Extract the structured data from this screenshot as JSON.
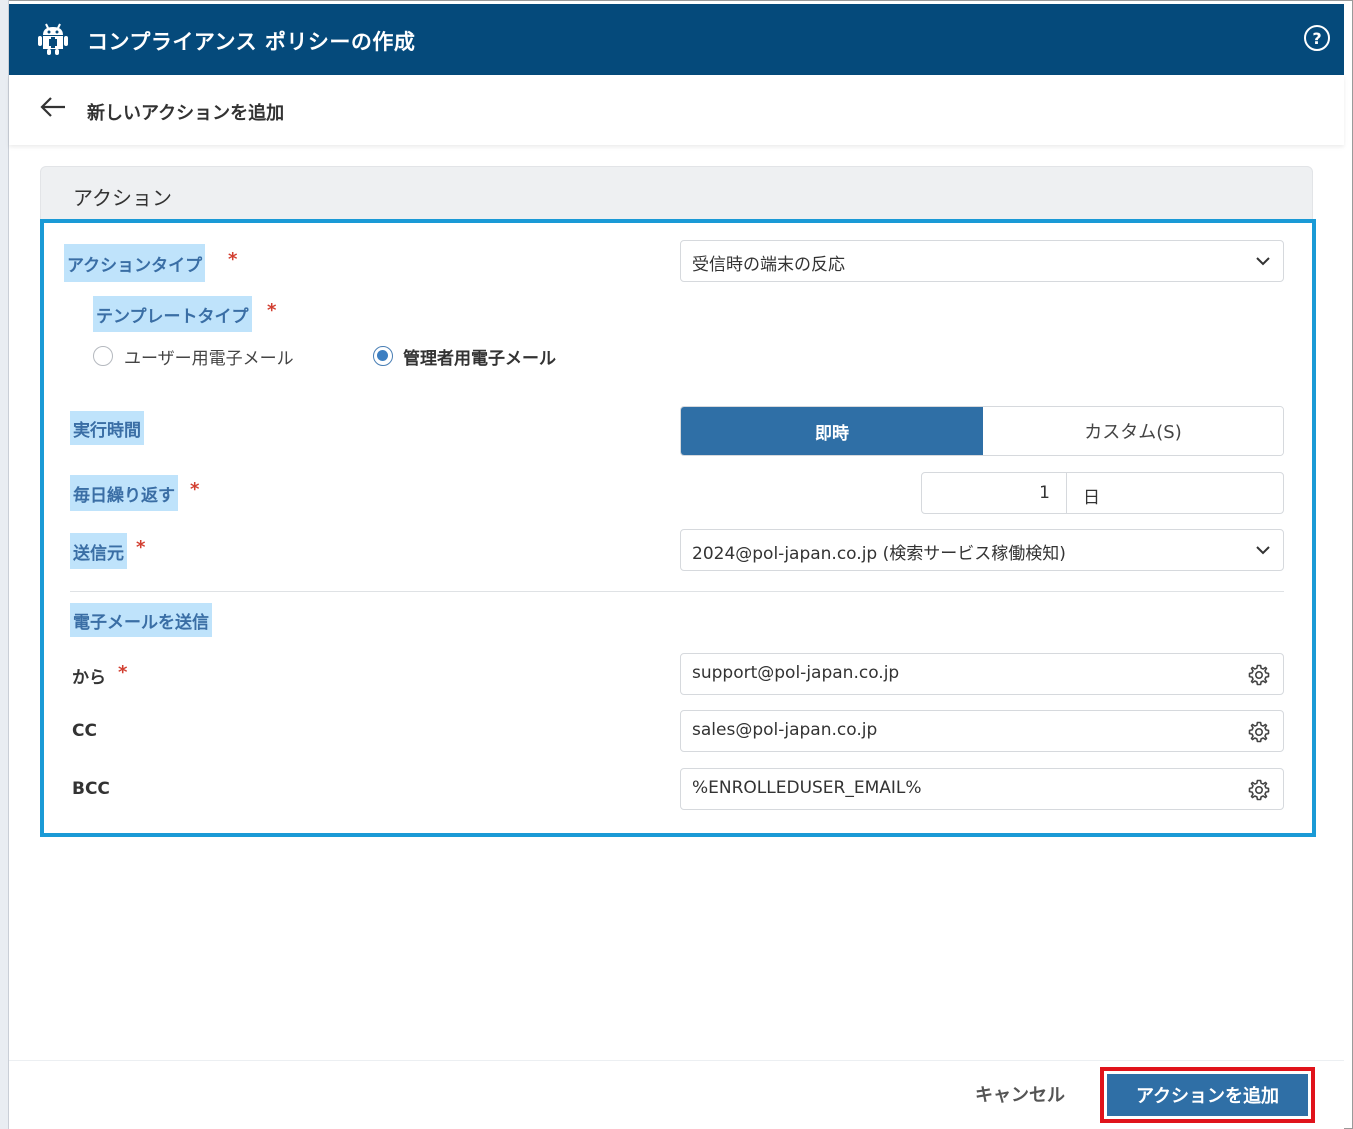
{
  "header": {
    "title": "コンプライアンス ポリシーの作成",
    "help_label": "?"
  },
  "subheader": {
    "title": "新しいアクションを追加"
  },
  "card": {
    "title": "アクション"
  },
  "form": {
    "action_type": {
      "label": "アクションタイプ",
      "required": "*",
      "value": "受信時の端末の反応"
    },
    "template_type": {
      "label": "テンプレートタイプ",
      "required": "*",
      "options": [
        {
          "label": "ユーザー用電子メール",
          "selected": false
        },
        {
          "label": "管理者用電子メール",
          "selected": true
        }
      ]
    },
    "execution_time": {
      "label": "実行時間",
      "options": [
        "即時",
        "カスタム(S)"
      ],
      "selected": "即時"
    },
    "repeat_daily": {
      "label": "毎日繰り返す",
      "required": "*",
      "value": "1",
      "unit": "日"
    },
    "sender": {
      "label": "送信元",
      "required": "*",
      "value": "2024@pol-japan.co.jp (検索サービス稼働検知)"
    },
    "send_email": {
      "label": "電子メールを送信"
    },
    "from": {
      "label": "から",
      "required": "*",
      "value": "support@pol-japan.co.jp"
    },
    "cc": {
      "label": "CC",
      "value": "sales@pol-japan.co.jp"
    },
    "bcc": {
      "label": "BCC",
      "value": "%ENROLLEDUSER_EMAIL%"
    }
  },
  "footer": {
    "cancel_label": "キャンセル",
    "add_label": "アクションを追加"
  },
  "colors": {
    "header_bg": "#054a7b",
    "accent": "#2f6fa6",
    "highlight_border": "#1a9ad6",
    "cta_border": "#e0131b",
    "label_highlight": "#bfe3fb"
  },
  "icons": {
    "app": "android-robot-icon",
    "help": "help-circle-icon",
    "back": "arrow-left-icon",
    "dropdown": "chevron-down-icon",
    "settings": "gear-icon"
  }
}
